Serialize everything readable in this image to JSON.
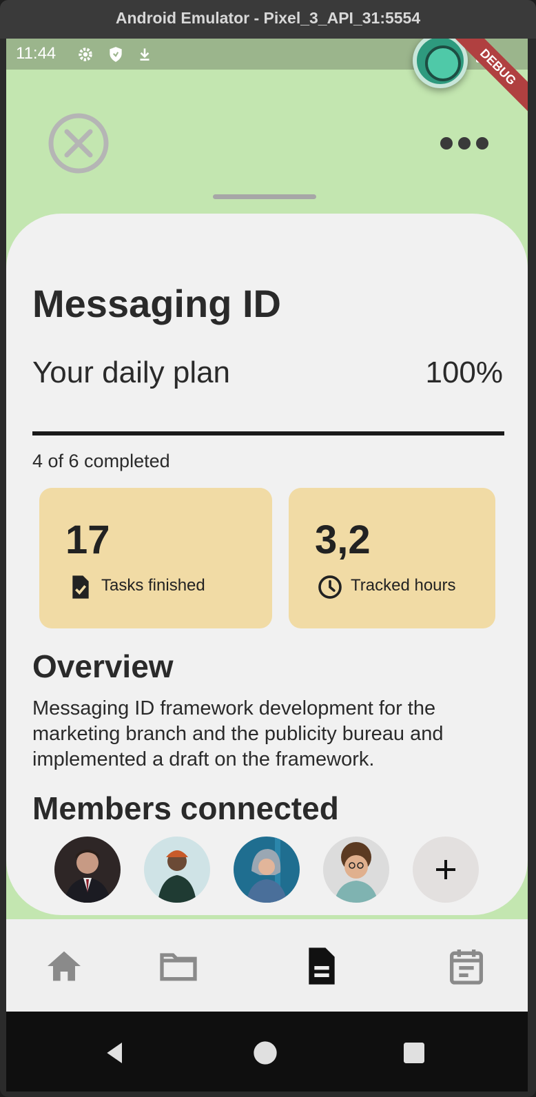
{
  "window": {
    "title": "Android Emulator - Pixel_3_API_31:5554"
  },
  "status_bar": {
    "time": "11:44",
    "icons": [
      "settings-icon",
      "shield-icon",
      "download-icon",
      "battery-icon"
    ],
    "debug_banner": "DEBUG"
  },
  "top_bar": {
    "close_icon": "close-circle-icon",
    "more_icon": "more-horizontal-icon"
  },
  "page": {
    "title": "Messaging ID",
    "plan_label": "Your daily plan",
    "plan_percent": "100%",
    "progress_fraction": 1.0,
    "progress_text": "4 of 6 completed"
  },
  "stats": [
    {
      "value": "17",
      "label": "Tasks finished",
      "icon": "task-check-icon"
    },
    {
      "value": "3,2",
      "label": "Tracked hours",
      "icon": "clock-icon"
    }
  ],
  "overview": {
    "title": "Overview",
    "text": "Messaging ID framework development for the marketing branch and the publicity bureau and implemented a draft on the framework."
  },
  "members": {
    "title": "Members connected",
    "avatars": [
      "member-avatar-1",
      "member-avatar-2",
      "member-avatar-3",
      "member-avatar-4"
    ],
    "add_icon": "plus-icon"
  },
  "bottom_nav": [
    {
      "icon": "home-icon",
      "active": false
    },
    {
      "icon": "folder-icon",
      "active": false
    },
    {
      "icon": "document-icon",
      "active": true
    },
    {
      "icon": "calendar-icon",
      "active": false
    }
  ],
  "system_nav": [
    "back-icon",
    "home-circle-icon",
    "recents-icon"
  ],
  "colors": {
    "background": "#c3e6b0",
    "sheet": "#f1f1f1",
    "card": "#f1dba5",
    "text": "#2a2a2a"
  }
}
